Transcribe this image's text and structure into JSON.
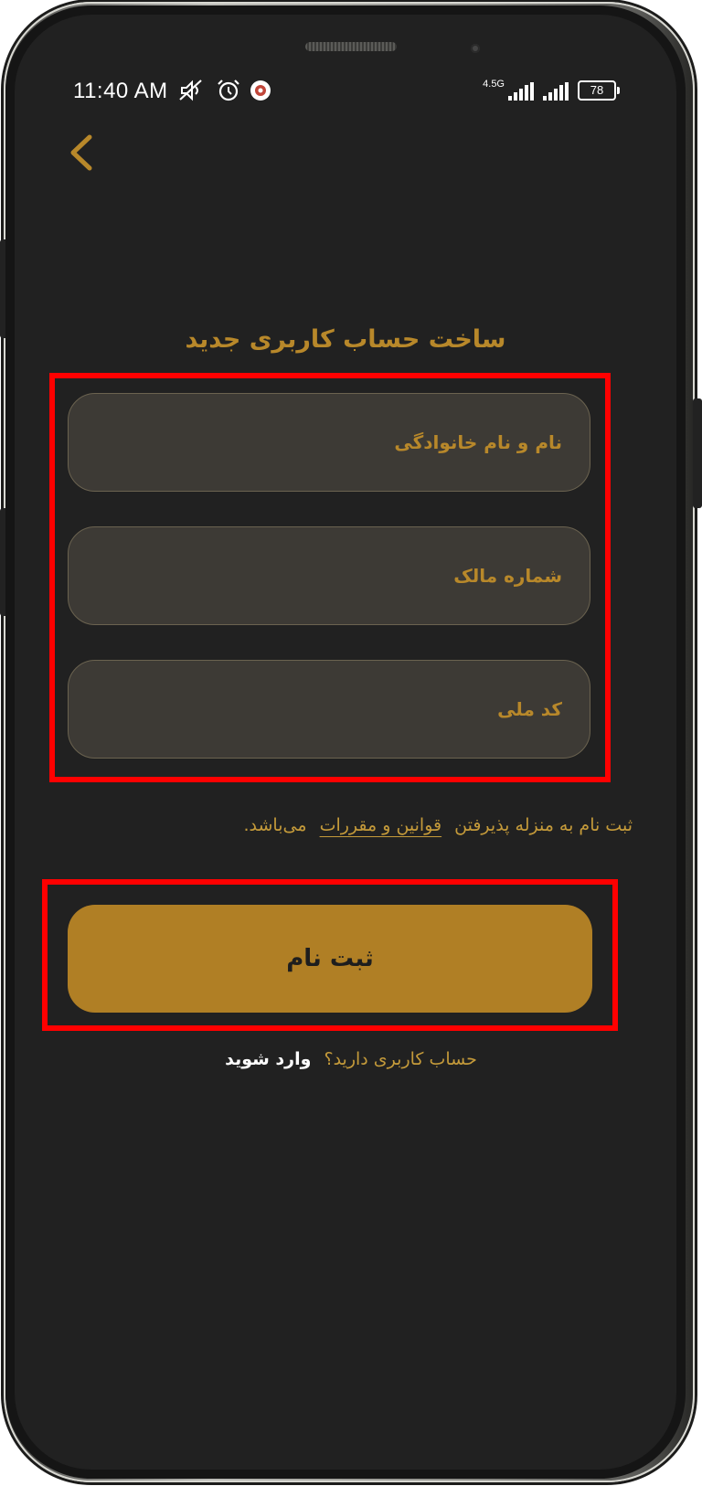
{
  "status_bar": {
    "time": "11:40 AM",
    "network_label": "4.5G",
    "battery": "78",
    "icons": [
      "mute-icon",
      "alarm-icon",
      "app-notification-icon",
      "signal-icon",
      "battery-icon"
    ]
  },
  "header": {
    "back_icon": "chevron-left-icon",
    "title": "ساخت حساب کاربری جدید"
  },
  "form": {
    "full_name_placeholder": "نام و نام خانوادگی",
    "owner_number_placeholder": "شماره مالک",
    "national_code_placeholder": "کد ملی"
  },
  "terms": {
    "prefix": "ثبت نام به منزله پذیرفتن",
    "link": "قوانین و مقررات",
    "suffix": "می‌باشد."
  },
  "submit": {
    "label": "ثبت نام"
  },
  "login": {
    "prompt": "حساب کاربری دارید؟",
    "link": "وارد شوید"
  },
  "colors": {
    "background": "#212121",
    "accent": "#b8882a",
    "button": "#b07f25",
    "field": "#3d3a35",
    "highlight": "#ff0000"
  }
}
